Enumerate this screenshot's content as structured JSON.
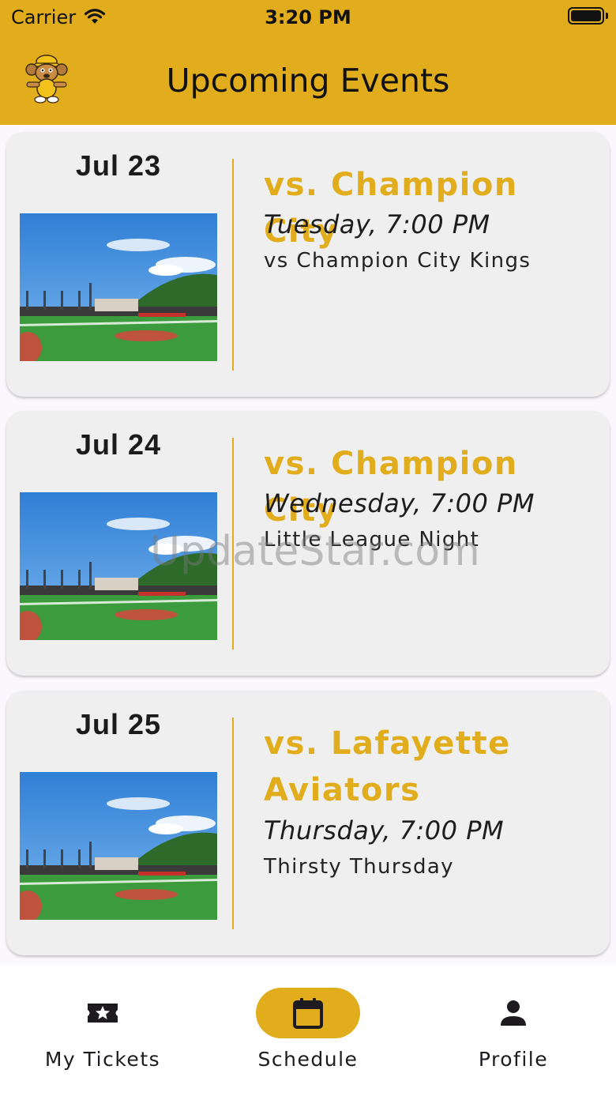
{
  "status_bar": {
    "carrier": "Carrier",
    "time": "3:20 PM"
  },
  "header": {
    "title": "Upcoming Events",
    "logo_icon": "mascot-logo"
  },
  "events": [
    {
      "date": "Jul 23",
      "opponent": "vs. Champion City",
      "when": "Tuesday, 7:00 PM",
      "note": "vs Champion City Kings"
    },
    {
      "date": "Jul 24",
      "opponent": "vs. Champion City",
      "when": "Wednesday, 7:00 PM",
      "note": "Little League Night"
    },
    {
      "date": "Jul 25",
      "opponent": "vs. Lafayette Aviators",
      "when": "Thursday, 7:00 PM",
      "note": "Thirsty Thursday"
    }
  ],
  "watermark": "UpdateStar.com",
  "bottom_nav": {
    "items": [
      {
        "label": "My Tickets",
        "icon": "ticket-star-icon",
        "active": false
      },
      {
        "label": "Schedule",
        "icon": "calendar-icon",
        "active": true
      },
      {
        "label": "Profile",
        "icon": "person-icon",
        "active": false
      }
    ]
  },
  "colors": {
    "accent": "#e1ad1d",
    "card_bg": "#efefef",
    "page_bg": "#fbf8fd"
  }
}
